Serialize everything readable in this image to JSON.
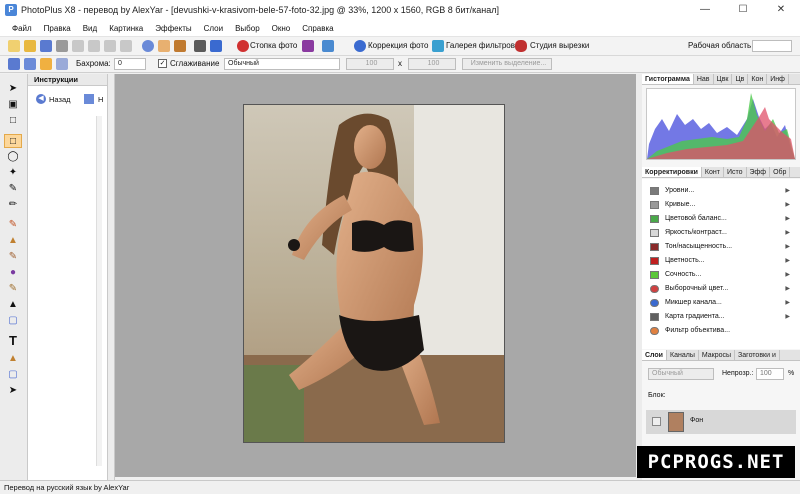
{
  "window": {
    "title": "PhotoPlus X8 - перевод by AlexYar - [devushki-v-krasivom-bele-57-foto-32.jpg @ 33%, 1200 x 1560, RGB 8 бит/канал]",
    "app_icon_letter": "P"
  },
  "menu": [
    "Файл",
    "Правка",
    "Вид",
    "Картинка",
    "Эффекты",
    "Слои",
    "Выбор",
    "Окно",
    "Справка"
  ],
  "toolbar": {
    "stock_photo": "Стопка фото",
    "photo_correction": "Коррекция фото",
    "filter_gallery": "Галерея фильтров",
    "cutout_studio": "Студия вырезки",
    "workspace_label": "Рабочая область"
  },
  "options_bar": {
    "feather_label": "Бахрома:",
    "feather_value": "0",
    "antialias_label": "Сглаживание",
    "mode_value": "Обычный",
    "width_value": "100",
    "x_sep": "x",
    "height_value": "100",
    "modify_selection": "Изменить выделение..."
  },
  "instructions": {
    "tab": "Инструкции",
    "back": "Назад",
    "home": "Н"
  },
  "histogram": {
    "tabs": [
      "Гистограмма",
      "Нав",
      "Цвк",
      "Цв",
      "Кон",
      "Инф"
    ]
  },
  "adjustments": {
    "tabs": [
      "Корректировки",
      "Конт",
      "Исто",
      "Эфф",
      "Обр"
    ],
    "items": [
      {
        "label": "Уровни...",
        "color": "#7a7a7a"
      },
      {
        "label": "Кривые...",
        "color": "#9a9a9a"
      },
      {
        "label": "Цветовой баланс...",
        "color": "#4aa84a"
      },
      {
        "label": "Яркость/контраст...",
        "color": "#d8d8d8"
      },
      {
        "label": "Тон/насыщенность...",
        "color": "#8a2a2a"
      },
      {
        "label": "Цветность...",
        "color": "#c02020"
      },
      {
        "label": "Сочность...",
        "color": "#5cc83a"
      },
      {
        "label": "Выборочный цвет...",
        "color": "#d04040"
      },
      {
        "label": "Микшер канала...",
        "color": "#3a6ad0"
      },
      {
        "label": "Карта градиента...",
        "color": "#606060"
      },
      {
        "label": "Фильтр объектива...",
        "color": "#e08040"
      }
    ]
  },
  "layers": {
    "tabs": [
      "Слои",
      "Каналы",
      "Макросы",
      "Заготовки и"
    ],
    "blend_mode": "Обычный",
    "opacity_label": "Непрозр.:",
    "opacity_value": "100",
    "opacity_unit": "%",
    "lock_label": "Блок:",
    "layer_name": "Фон"
  },
  "status": {
    "text": "Перевод на русский язык by AlexYar"
  },
  "watermark": "PCPROGS.NET",
  "colors": {
    "canvas_bg": "#a8a8a8",
    "selected_tool": "#fcd79b",
    "hist_blue": "#5a60e0",
    "hist_green": "#4cc84c",
    "hist_red": "#e0506a"
  }
}
